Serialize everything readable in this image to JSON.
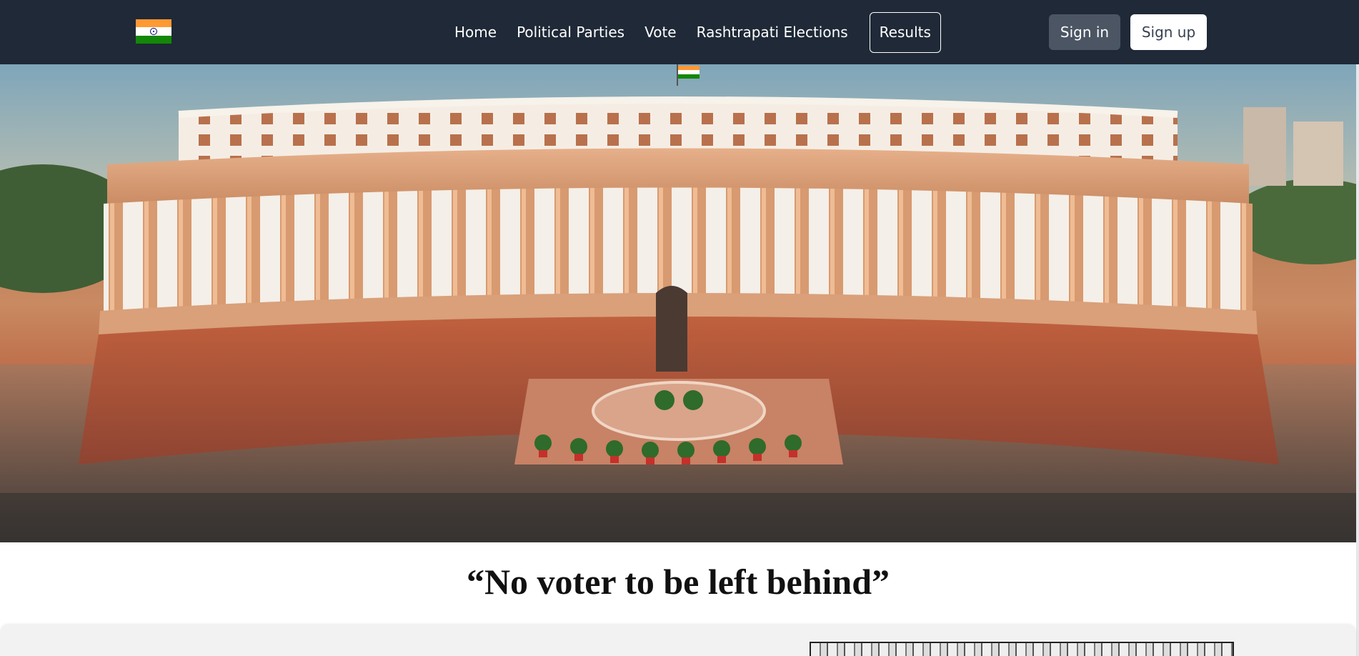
{
  "navbar": {
    "logo": "india-flag",
    "links": [
      {
        "label": "Home"
      },
      {
        "label": "Political Parties"
      },
      {
        "label": "Vote"
      },
      {
        "label": "Rashtrapati Elections"
      }
    ],
    "active_link": {
      "label": "Results"
    },
    "sign_in_label": "Sign in",
    "sign_up_label": "Sign up"
  },
  "hero": {
    "image": "parliament-house-photo"
  },
  "slogan": {
    "text": "“No voter to be left behind”"
  },
  "lower_section": {
    "image": "decorative-card-image"
  },
  "colors": {
    "navbar_bg": "#1f2937",
    "signin_bg": "#4b5563",
    "signup_bg": "#ffffff",
    "lower_bg": "#f2f2f2"
  }
}
